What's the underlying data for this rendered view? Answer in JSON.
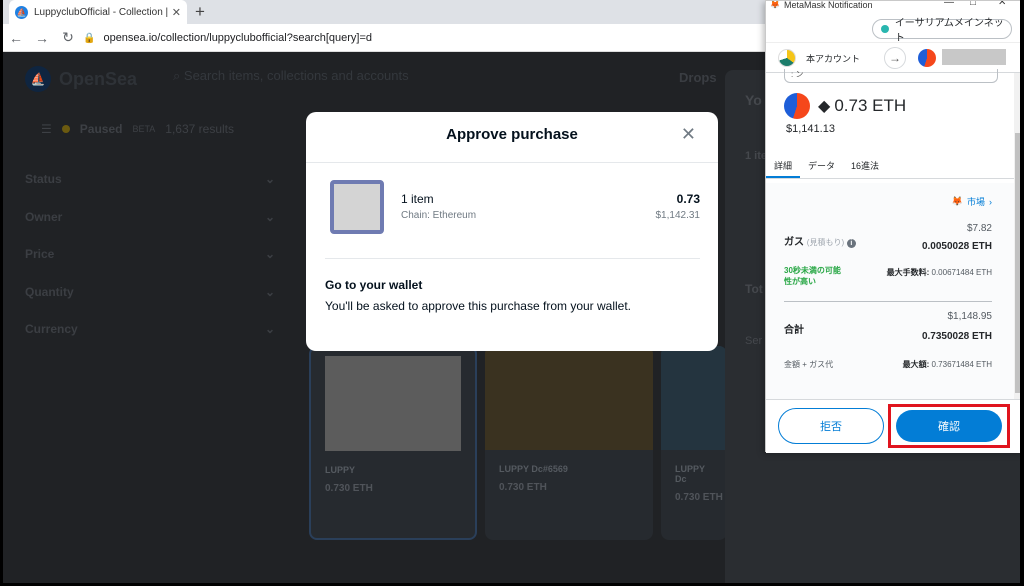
{
  "browser": {
    "tab_title": "LuppyclubOfficial - Collection | O",
    "tab_close": "✕",
    "new_tab": "+",
    "url": "opensea.io/collection/luppyclubofficial?search[query]=d"
  },
  "opensea": {
    "logo_text": "OpenSea",
    "search_placeholder": "Search items, collections and accounts",
    "nav_drops": "Drops",
    "filter_status": "Paused",
    "filter_beta": "BETA",
    "results": "1,637 results",
    "sidebar": [
      "Status",
      "Owner",
      "Price",
      "Quantity",
      "Currency"
    ],
    "cards": [
      {
        "name": "LUPPY",
        "price": "0.730 ETH"
      },
      {
        "name": "LUPPY Dc#6569",
        "price": "0.730 ETH"
      },
      {
        "name": "LUPPY Dc",
        "price": "0.730 ETH"
      }
    ],
    "right_panel": {
      "title": "Yo",
      "count": "1 ite",
      "total": "Tot",
      "service": "Ser"
    }
  },
  "modal": {
    "title": "Approve purchase",
    "close": "✕",
    "item_count": "1 item",
    "chain": "Chain: Ethereum",
    "price_eth": "0.73",
    "price_usd": "$1,142.31",
    "go_title": "Go to your wallet",
    "go_desc": "You'll be asked to approve this purchase from your wallet."
  },
  "metamask": {
    "window_title": "MetaMask Notification",
    "network": "イーサリアムメインネット",
    "account_name": "本アカウント",
    "origin": ": ン",
    "value_eth": "0.73 ETH",
    "value_usd": "$1,141.13",
    "tabs": [
      "詳細",
      "データ",
      "16進法"
    ],
    "market": "市場",
    "gas_usd": "$7.82",
    "gas_label": "ガス",
    "gas_estimate": "(見積もり)",
    "gas_eth": "0.0050028 ETH",
    "likely": "30秒未満の可能性が高い",
    "max_fee_label": "最大手数料:",
    "max_fee": "0.00671484 ETH",
    "total_usd": "$1,148.95",
    "total_label": "合計",
    "total_eth": "0.7350028 ETH",
    "amount_gas": "金額 + ガス代",
    "max_amount_label": "最大額:",
    "max_amount": "0.73671484 ETH",
    "reject": "拒否",
    "confirm": "確認"
  }
}
